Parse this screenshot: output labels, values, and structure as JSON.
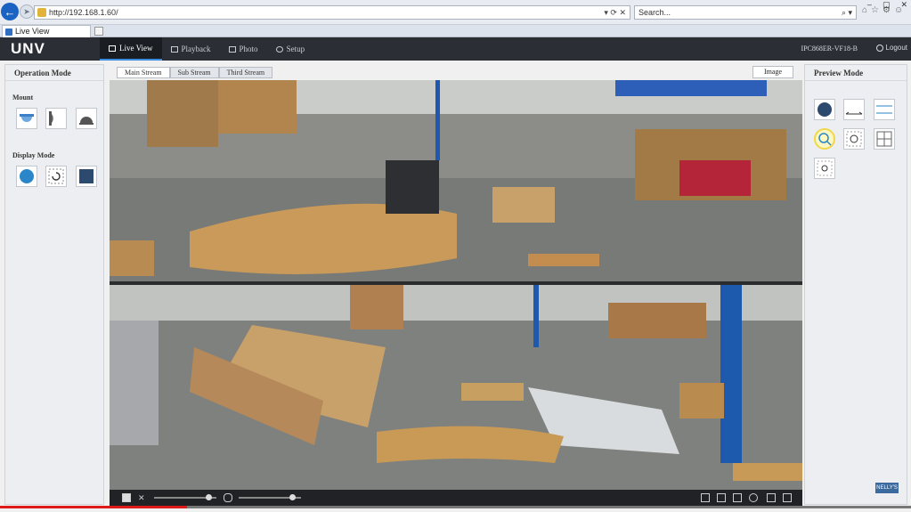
{
  "browser": {
    "url": "http://192.168.1.60/",
    "search_placeholder": "Search...",
    "tab_title": "Live View"
  },
  "app": {
    "logo": "UNV",
    "nav": [
      {
        "label": "Live View",
        "icon": "monitor-icon",
        "active": true
      },
      {
        "label": "Playback",
        "icon": "film-icon",
        "active": false
      },
      {
        "label": "Photo",
        "icon": "image-icon",
        "active": false
      },
      {
        "label": "Setup",
        "icon": "gear-icon",
        "active": false
      }
    ],
    "device_id": "IPC868ER-VF18-B",
    "logout_label": "Logout"
  },
  "left_panel": {
    "title": "Operation Mode",
    "mount_label": "Mount",
    "display_label": "Display Mode",
    "mount_icons": [
      "ceiling-mount-icon",
      "wall-mount-icon",
      "desktop-mount-icon"
    ],
    "display_icons": [
      "fisheye-icon",
      "refresh-icon",
      "panorama-square-icon"
    ]
  },
  "stream_tabs": [
    "Main Stream",
    "Sub Stream",
    "Third Stream"
  ],
  "image_button": "Image",
  "right_panel": {
    "title": "Preview Mode",
    "icons": [
      "fisheye-circle-icon",
      "panorama-180-icon",
      "dual-panorama-icon",
      "ptz-zoom-icon",
      "fisheye-ptz-icon",
      "quad-view-icon",
      "single-ptz-icon"
    ]
  },
  "watermark": "NELLY'S",
  "colors": {
    "accent": "#3c8de0",
    "header": "#2b2f35",
    "progress": "#e01919"
  }
}
